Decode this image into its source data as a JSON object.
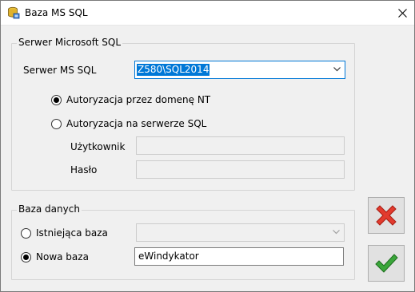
{
  "window": {
    "title": "Baza MS SQL"
  },
  "server_group": {
    "legend": "Serwer Microsoft SQL",
    "server_label": "Serwer MS SQL",
    "server_value": "Z580\\SQL2014",
    "auth_nt_label": "Autoryzacja przez domenę NT",
    "auth_sql_label": "Autoryzacja na serwerze SQL",
    "user_label": "Użytkownik",
    "user_value": "",
    "password_label": "Hasło",
    "password_value": ""
  },
  "database_group": {
    "legend": "Baza danych",
    "existing_label": "Istniejąca baza",
    "existing_value": "",
    "new_label": "Nowa baza",
    "new_value": "eWindykator"
  },
  "buttons": {
    "cancel_icon": "red-x-icon",
    "ok_icon": "green-check-icon"
  },
  "colors": {
    "selection": "#0078d7",
    "cancel": "#e23b2e",
    "ok": "#3aa63a"
  }
}
